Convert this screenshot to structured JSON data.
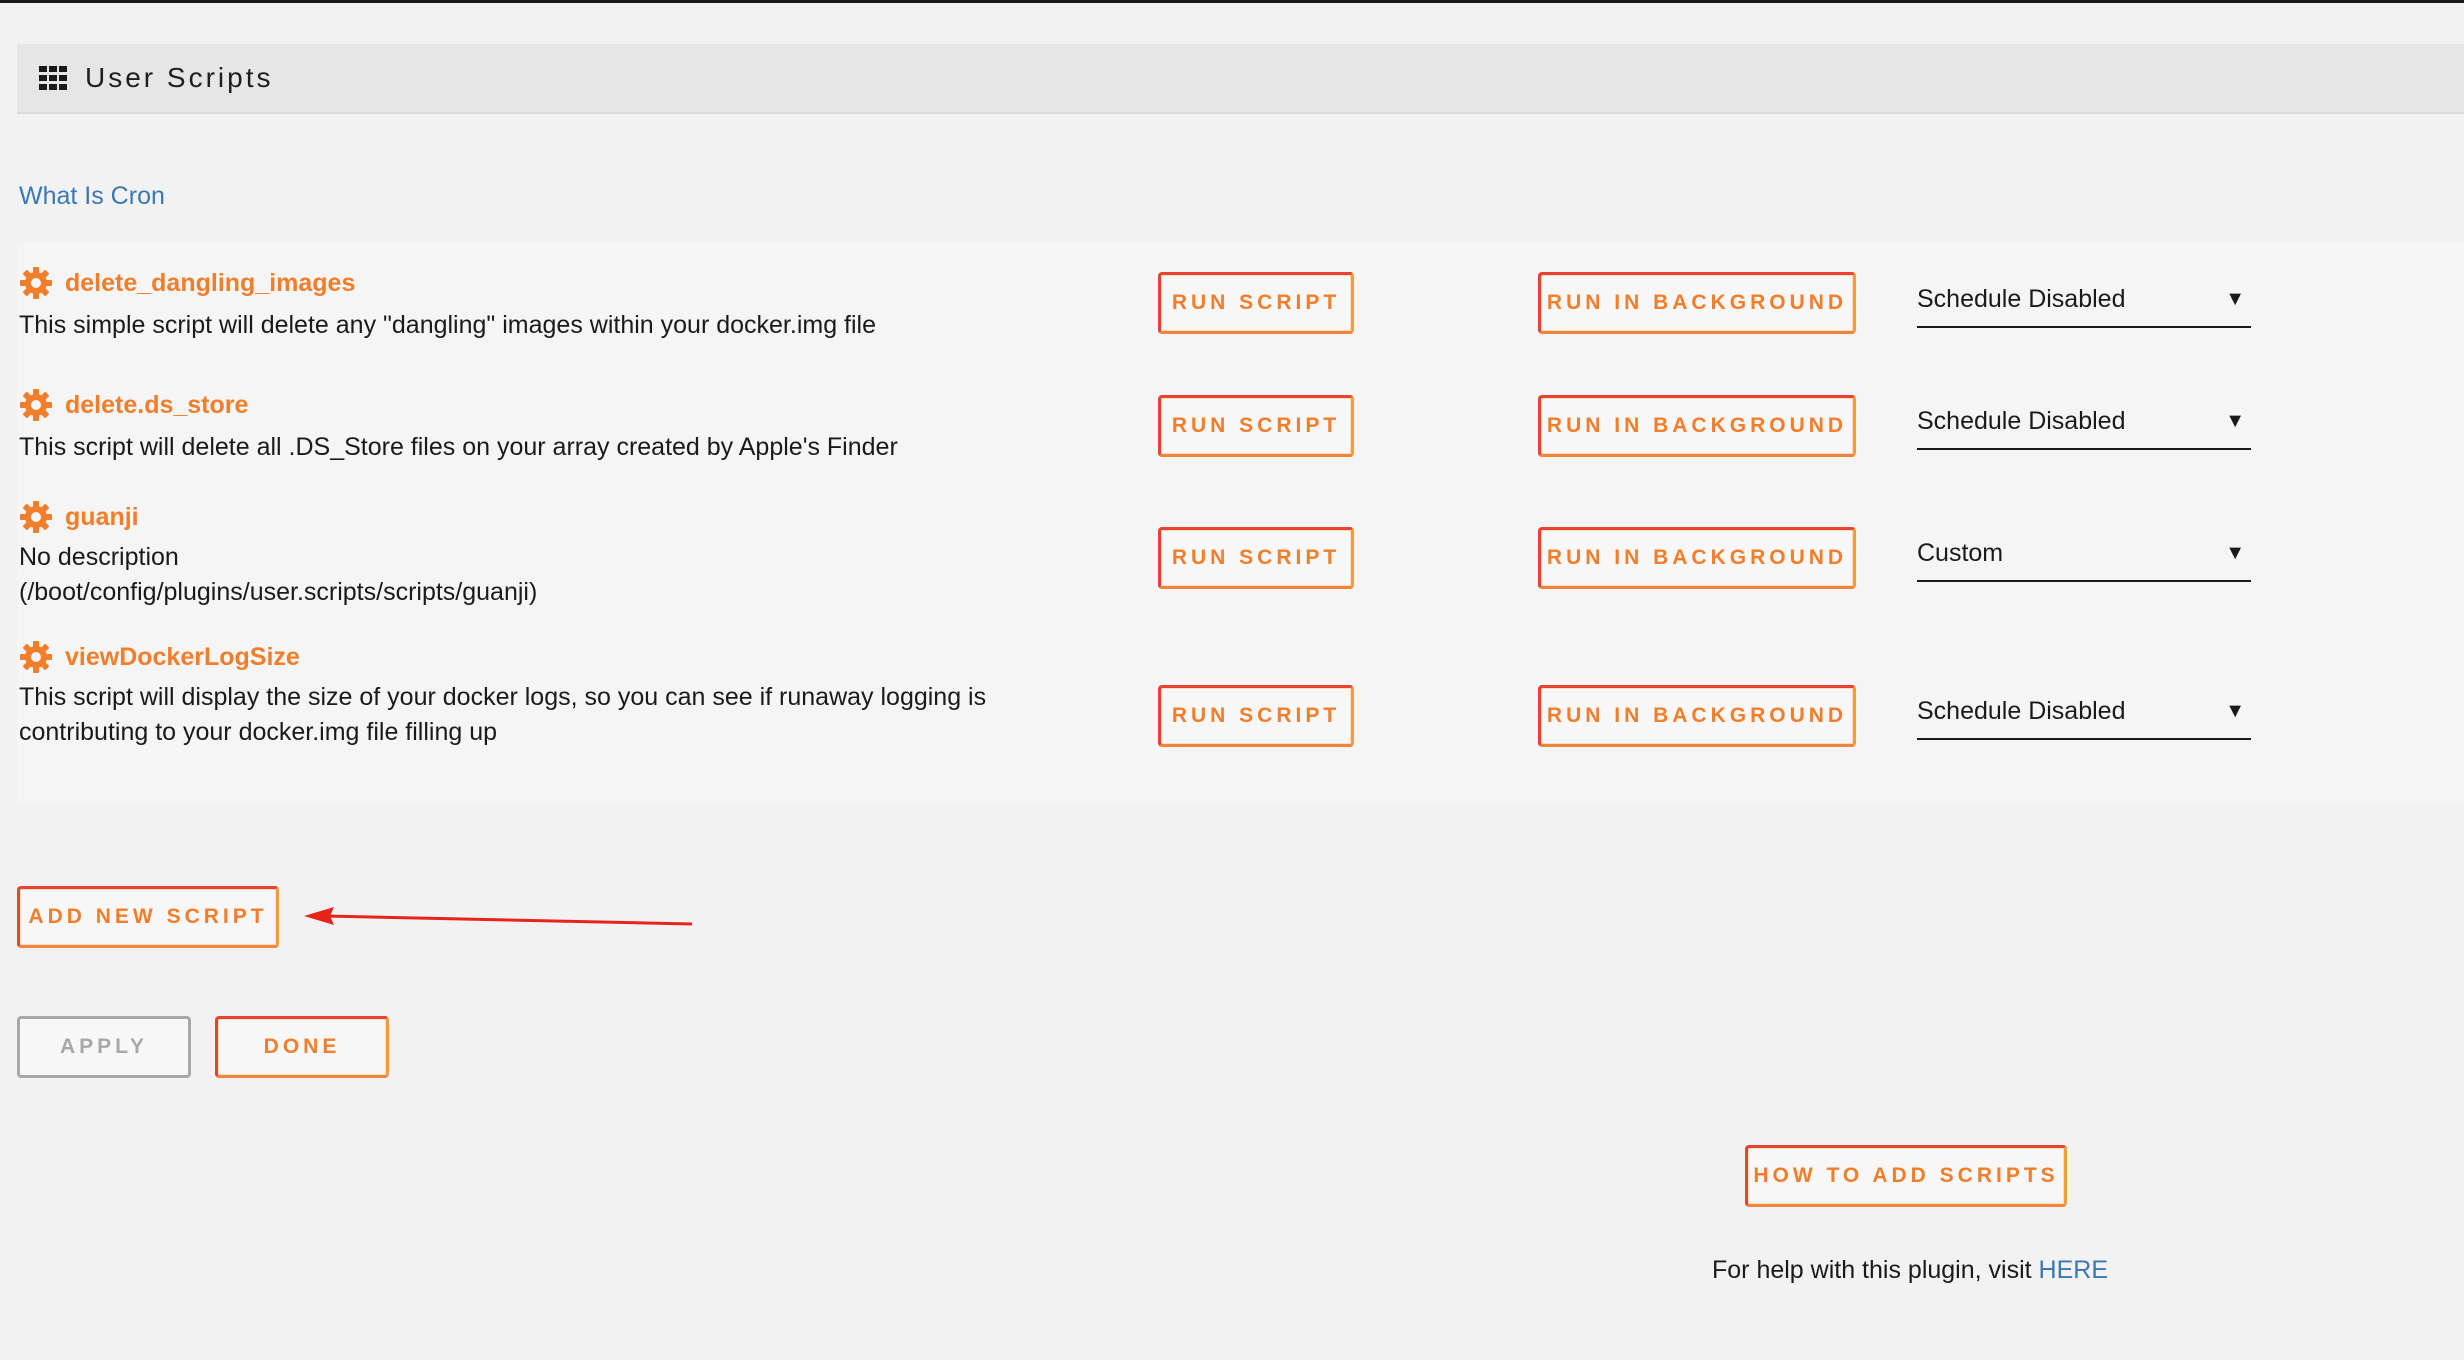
{
  "header": {
    "title": "User Scripts",
    "icon": "grid-icon"
  },
  "links": {
    "what_is_cron": "What Is Cron"
  },
  "scripts": [
    {
      "name": "delete_dangling_images",
      "description": "This simple script will delete any \"dangling\" images within your docker.img file",
      "run_label": "RUN SCRIPT",
      "background_label": "RUN IN BACKGROUND",
      "schedule": "Schedule Disabled"
    },
    {
      "name": "delete.ds_store",
      "description": "This script will delete all .DS_Store files on your array created by Apple's Finder",
      "run_label": "RUN SCRIPT",
      "background_label": "RUN IN BACKGROUND",
      "schedule": "Schedule Disabled"
    },
    {
      "name": "guanji",
      "description_line1": "No description",
      "description_line2": "(/boot/config/plugins/user.scripts/scripts/guanji)",
      "run_label": "RUN SCRIPT",
      "background_label": "RUN IN BACKGROUND",
      "schedule": "Custom"
    },
    {
      "name": "viewDockerLogSize",
      "description_line1": "This script will display the size of your docker logs, so you can see if runaway logging is",
      "description_line2": "contributing to your docker.img file filling up",
      "run_label": "RUN SCRIPT",
      "background_label": "RUN IN BACKGROUND",
      "schedule": "Schedule Disabled"
    }
  ],
  "actions": {
    "add_new_script": "ADD NEW SCRIPT",
    "apply": "APPLY",
    "done": "DONE",
    "how_to_add": "HOW TO ADD SCRIPTS"
  },
  "footer": {
    "help_prefix": "For help with this plugin, visit ",
    "help_link": "HERE"
  },
  "colors": {
    "accent_orange": "#f27d2a",
    "accent_red": "#e8432f",
    "link_blue": "#3a78b5",
    "annotation_arrow": "#e8231a"
  }
}
